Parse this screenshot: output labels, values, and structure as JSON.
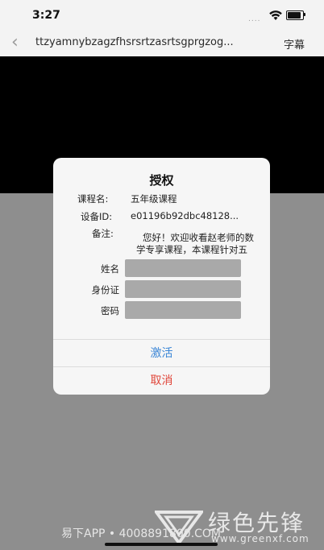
{
  "status_bar": {
    "time": "3:27",
    "signal": "....",
    "battery_level": 0.9
  },
  "nav": {
    "title": "ttzyamnybzagzfhsrsrtzasrtsgprgzog...",
    "subtitle_button": "字幕"
  },
  "dialog": {
    "title": "授权",
    "course_label": "课程名:",
    "course_value": "五年级课程",
    "device_label": "设备ID:",
    "device_value": "e01196b92dbc48128...",
    "note_label": "备注:",
    "note_value": "您好！欢迎收看赵老师的数学专享课程，本课程针对五年级学生",
    "fields": [
      {
        "label": "姓名",
        "value": ""
      },
      {
        "label": "身份证",
        "value": ""
      },
      {
        "label": "密码",
        "value": ""
      }
    ],
    "activate_label": "激活",
    "cancel_label": "取消"
  },
  "watermark": {
    "text": "易下APP • 4008891800.COM",
    "logo_cn": "绿色先锋",
    "logo_url": "www.greenxf.com"
  },
  "colors": {
    "accent": "#3b86d6",
    "danger": "#e0463a",
    "overlay": "#8e8e8e"
  }
}
